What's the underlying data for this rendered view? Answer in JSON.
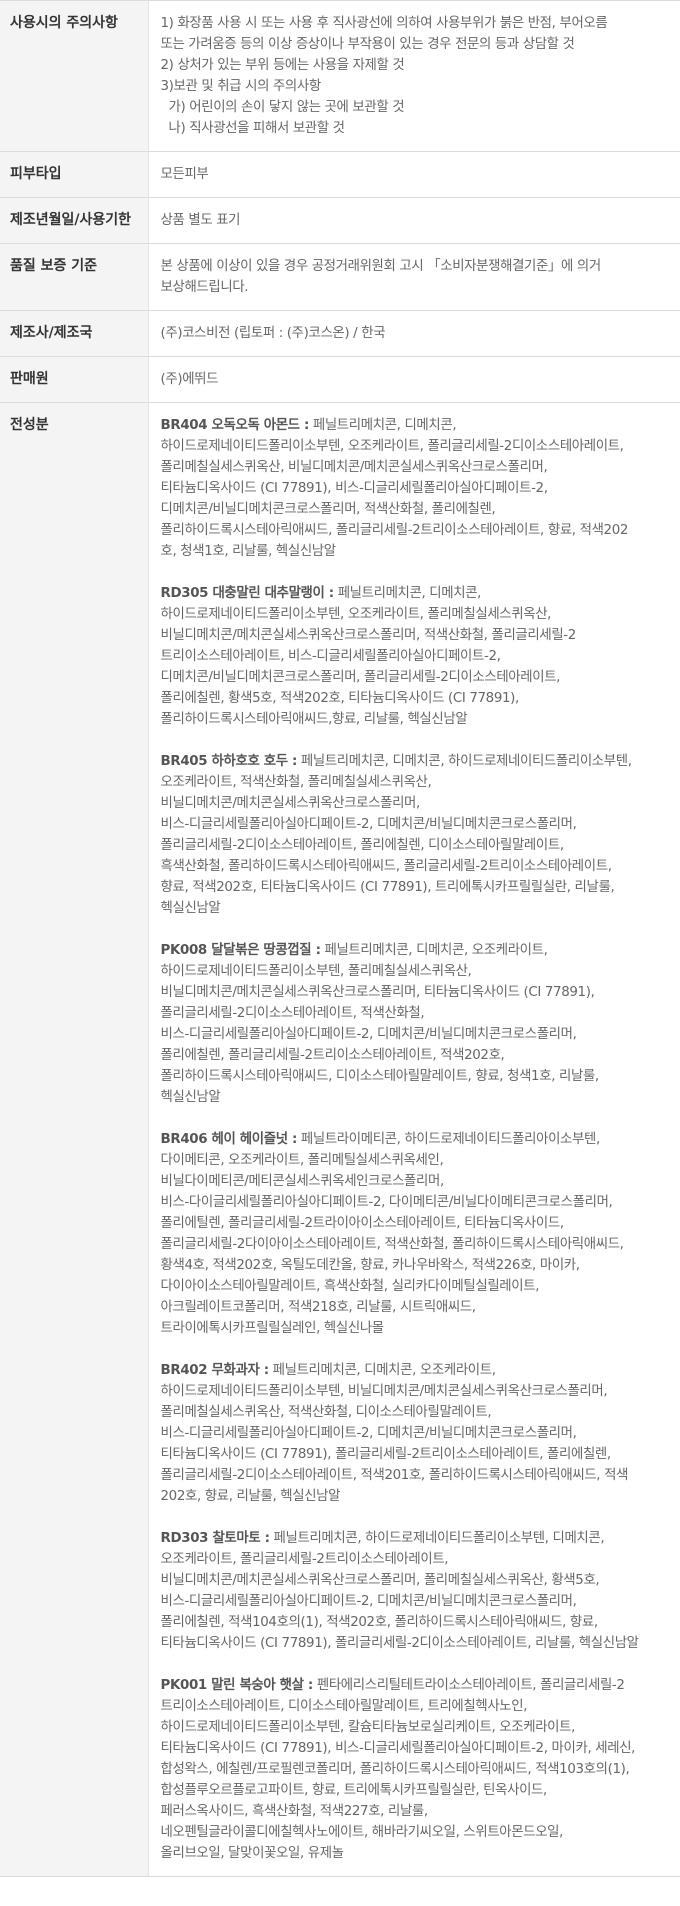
{
  "rows": {
    "caution": {
      "label": "사용시의 주의사항",
      "lines": [
        "1) 화장품 사용 시 또는 사용 후 직사광선에 의하여 사용부위가 붉은 반점, 부어오름",
        "또는 가려움증 등의 이상 증상이나 부작용이 있는 경우 전문의 등과 상담할 것",
        "2) 상처가 있는 부위 등에는 사용을 자제할 것",
        "3)보관 및 취급 시의 주의사항",
        "가) 어린이의 손이 닿지 않는 곳에 보관할 것",
        "나) 직사광선을 피해서 보관할 것"
      ]
    },
    "skin_type": {
      "label": "피부타입",
      "value": "모든피부"
    },
    "manufacture_date": {
      "label": "제조년월일/사용기한",
      "value": "상품 별도 표기"
    },
    "quality": {
      "label": "품질 보증 기준",
      "lines": [
        "본 상품에 이상이 있을 경우 공정거래위원회 고시 「소비자분쟁해결기준」에 의거",
        "보상해드립니다."
      ]
    },
    "manufacturer": {
      "label": "제조사/제조국",
      "value": "(주)코스비전 (립토퍼 : (주)코스온) / 한국"
    },
    "seller": {
      "label": "판매원",
      "value": "(주)에뛰드"
    },
    "ingredients": {
      "label": "전성분",
      "products": [
        {
          "name": "BR404 오독오독 아몬드 :",
          "lines": [
            " 페닐트리메치콘, 디메치콘,",
            "하이드로제네이티드폴리이소부텐, 오조케라이트, 폴리글리세릴-2디이소스테아레이트,",
            "폴리메칠실세스퀴옥산, 비닐디메치콘/메치콘실세스퀴옥산크로스폴리머,",
            "티타늄디옥사이드 (CI 77891), 비스-디글리세릴폴리아실아디페이트-2,",
            "디메치콘/비닐디메치콘크로스폴리머, 적색산화철, 폴리에칠렌,",
            "폴리하이드록시스테아릭애씨드, 폴리글리세릴-2트리이소스테아레이트, 향료, 적색202",
            "호, 청색1호, 리날룰, 헥실신남알"
          ]
        },
        {
          "name": "RD305 대충말린 대추말랭이 :",
          "lines": [
            " 페닐트리메치콘, 디메치콘,",
            "하이드로제네이티드폴리이소부텐, 오조케라이트, 폴리메칠실세스퀴옥산,",
            "비닐디메치콘/메치콘실세스퀴옥산크로스폴리머, 적색산화철, 폴리글리세릴-2",
            "트리이소스테아레이트, 비스-디글리세릴폴리아실아디페이트-2,",
            "디메치콘/비닐디메치콘크로스폴리머, 폴리글리세릴-2디이소스테아레이트,",
            "폴리에칠렌, 황색5호, 적색202호, 티타늄디옥사이드 (CI 77891),",
            "폴리하이드록시스테아릭애씨드,향료, 리날룰, 헥실신남알"
          ]
        },
        {
          "name": "BR405 하하호호 호두 :",
          "lines": [
            " 페닐트리메치콘, 디메치콘, 하이드로제네이티드폴리이소부텐,",
            "오조케라이트, 적색산화철, 폴리메칠실세스퀴옥산,",
            "비닐디메치콘/메치콘실세스퀴옥산크로스폴리머,",
            "비스-디글리세릴폴리아실아디페이트-2, 디메치콘/비닐디메치콘크로스폴리머,",
            "폴리글리세릴-2디이소스테아레이트, 폴리에칠렌, 디이소스테아릴말레이트,",
            "흑색산화철, 폴리하이드록시스테아릭애씨드, 폴리글리세릴-2트리이소스테아레이트,",
            "향료, 적색202호, 티타늄디옥사이드 (CI 77891), 트리에톡시카프릴릴실란, 리날룰,",
            "헥실신남알"
          ]
        },
        {
          "name": "PK008 달달볶은 땅콩껍질 :",
          "lines": [
            " 페닐트리메치콘, 디메치콘, 오조케라이트,",
            "하이드로제네이티드폴리이소부텐, 폴리메칠실세스퀴옥산,",
            "비닐디메치콘/메치콘실세스퀴옥산크로스폴리머, 티타늄디옥사이드 (CI 77891),",
            "폴리글리세릴-2디이소스테아레이트, 적색산화철,",
            "비스-디글리세릴폴리아실아디페이트-2, 디메치콘/비닐디메치콘크로스폴리머,",
            "폴리에칠렌, 폴리글리세릴-2트리이소스테아레이트, 적색202호,",
            "폴리하이드록시스테아릭애씨드, 디이소스테아릴말레이트, 향료, 청색1호, 리날룰,",
            "헥실신남알"
          ]
        },
        {
          "name": "BR406 헤이 헤이즐넛 :",
          "lines": [
            " 페닐트라이메티콘, 하이드로제네이티드폴리아이소부텐,",
            "다이메티콘, 오조케라이트, 폴리메틸실세스퀴옥세인,",
            "비닐다이메티콘/메티콘실세스퀴옥세인크로스폴리머,",
            "비스-다이글리세릴폴리아실아디페이트-2, 다이메티콘/비닐다이메티콘크로스폴리머,",
            "폴리에틸렌, 폴리글리세릴-2트라이아이소스테아레이트, 티타늄디옥사이드,",
            "폴리글리세릴-2다이아이소스테아레이트, 적색산화철, 폴리하이드록시스테아릭애씨드,",
            "황색4호, 적색202호, 옥틸도데칸올, 향료, 카나우바왁스, 적색226호, 마이카,",
            "다이아이소스테아릴말레이트, 흑색산화철, 실리카다이메틸실릴레이트,",
            "아크릴레이트코폴리머, 적색218호, 리날룰, 시트릭애씨드,",
            "트라이에톡시카프릴릴실레인, 헥실신나몰"
          ]
        },
        {
          "name": "BR402 무화과자 :",
          "lines": [
            " 페닐트리메치콘, 디메치콘, 오조케라이트,",
            "하이드로제네이티드폴리이소부텐, 비닐디메치콘/메치콘실세스퀴옥산크로스폴리머,",
            "폴리메칠실세스퀴옥산, 적색산화철, 디이소스테아릴말레이트,",
            "비스-디글리세릴폴리아실아디페이트-2, 디메치콘/비닐디메치콘크로스폴리머,",
            "티타늄디옥사이드 (CI 77891), 폴리글리세릴-2트리이소스테아레이트, 폴리에칠렌,",
            "폴리글리세릴-2디이소스테아레이트, 적색201호, 폴리하이드록시스테아릭애씨드, 적색",
            "202호, 향료, 리날룰, 헥실신남알"
          ]
        },
        {
          "name": "RD303 찰토마토 :",
          "lines": [
            " 페닐트리메치콘, 하이드로제네이티드폴리이소부텐, 디메치콘,",
            "오조케라이트, 폴리글리세릴-2트리이소스테아레이트,",
            "비닐디메치콘/메치콘실세스퀴옥산크로스폴리머, 폴리메칠실세스퀴옥산, 황색5호,",
            "비스-디글리세릴폴리아실아디페이트-2, 디메치콘/비닐디메치콘크로스폴리머,",
            "폴리에칠렌, 적색104호의(1), 적색202호, 폴리하이드록시스테아릭애씨드, 향료,",
            "티타늄디옥사이드 (CI 77891), 폴리글리세릴-2디이소스테아레이트, 리날룰, 헥실신남알"
          ]
        },
        {
          "name": "PK001 말린 복숭아 햇살 :",
          "lines": [
            "  펜타에리스리틸테트라이소스테아레이트, 폴리글리세릴-2",
            "트리이소스테아레이트, 디이소스테아릴말레이트, 트리에칠헥사노인,",
            "하이드로제네이티드폴리이소부텐, 칼슘티타늄보로실리케이트, 오조케라이트,",
            "티타늄디옥사이드 (CI 77891), 비스-디글리세릴폴리아실아디페이트-2, 마이카, 세레신,",
            "합성왁스, 에칠렌/프로필렌코폴리머, 폴리하이드록시스테아릭애씨드, 적색103호의(1),",
            "합성플루오르플로고파이트, 향료, 트리에톡시카프릴릴실란, 틴옥사이드,",
            "페러스옥사이드, 흑색산화철, 적색227호, 리날룰,",
            "네오펜틸글라이콜디에칠헥사노에이트, 해바라기씨오일, 스위트아몬드오일,",
            "올리브오일, 달맞이꽃오일, 유제놀"
          ]
        }
      ]
    }
  }
}
